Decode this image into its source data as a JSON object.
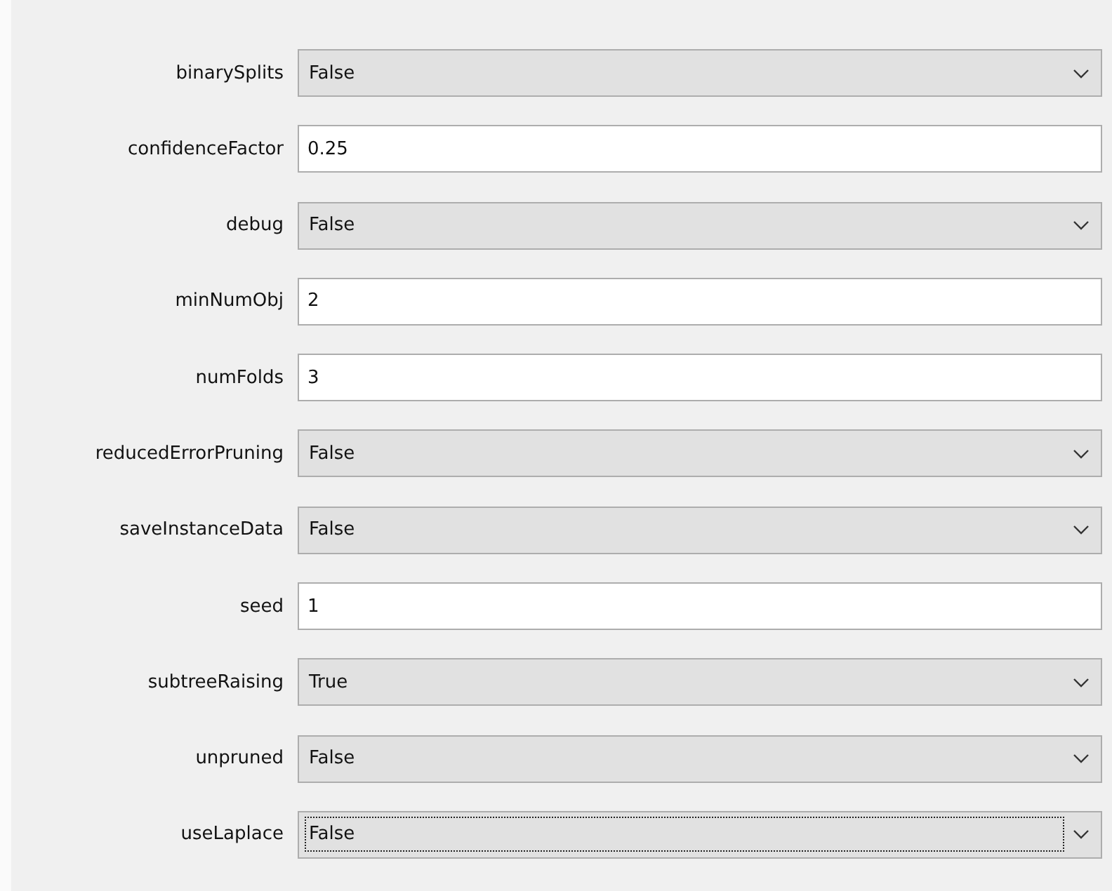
{
  "properties": [
    {
      "label": "binarySplits",
      "kind": "dropdown",
      "value": "False",
      "focused": false
    },
    {
      "label": "confidenceFactor",
      "kind": "text",
      "value": "0.25",
      "focused": false
    },
    {
      "label": "debug",
      "kind": "dropdown",
      "value": "False",
      "focused": false
    },
    {
      "label": "minNumObj",
      "kind": "text",
      "value": "2",
      "focused": false
    },
    {
      "label": "numFolds",
      "kind": "text",
      "value": "3",
      "focused": false
    },
    {
      "label": "reducedErrorPruning",
      "kind": "dropdown",
      "value": "False",
      "focused": false
    },
    {
      "label": "saveInstanceData",
      "kind": "dropdown",
      "value": "False",
      "focused": false
    },
    {
      "label": "seed",
      "kind": "text",
      "value": "1",
      "focused": false
    },
    {
      "label": "subtreeRaising",
      "kind": "dropdown",
      "value": "True",
      "focused": false
    },
    {
      "label": "unpruned",
      "kind": "dropdown",
      "value": "False",
      "focused": false
    },
    {
      "label": "useLaplace",
      "kind": "dropdown",
      "value": "False",
      "focused": true
    }
  ]
}
